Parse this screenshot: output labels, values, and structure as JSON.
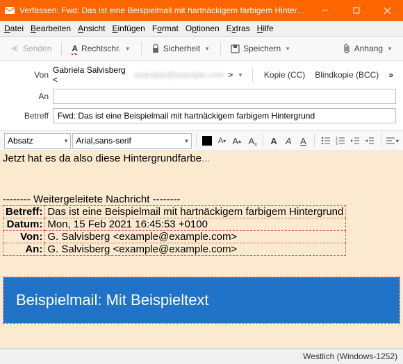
{
  "titlebar": {
    "title": "Verfassen: Fwd: Das ist eine Beispielmail mit hartnäckigem farbigem Hintergrund - Thunderbird"
  },
  "menu": {
    "datei": "Datei",
    "bearbeiten": "Bearbeiten",
    "ansicht": "Ansicht",
    "einfuegen": "Einfügen",
    "format": "Format",
    "optionen": "Optionen",
    "extras": "Extras",
    "hilfe": "Hilfe"
  },
  "toolbar": {
    "senden": "Senden",
    "rechtschr": "Rechtschr.",
    "sicherheit": "Sicherheit",
    "speichern": "Speichern",
    "anhang": "Anhang"
  },
  "fields": {
    "von_label": "Von",
    "from_name": "Gabriela Salvisberg <",
    "from_masked": "example@example.com",
    "from_close": ">",
    "kopie": "Kopie (CC)",
    "blindkopie": "Blindkopie (BCC)",
    "an_label": "An",
    "an_value": "",
    "betreff_label": "Betreff",
    "betreff_value": "Fwd: Das ist eine Beispielmail mit hartnäckigem farbigem Hintergrund"
  },
  "format": {
    "paragraph": "Absatz",
    "font": "Arial,sans-serif"
  },
  "body": {
    "typed": "Jetzt hat es da also diese Hintergrundfarbe",
    "cursor_tail": "...",
    "fwd_divider": "-------- Weitergeleitete Nachricht --------",
    "rows": {
      "betreff_k": "Betreff:",
      "betreff_v": "Das ist eine Beispielmail mit hartnäckigem farbigem Hintergrund",
      "datum_k": "Datum:",
      "datum_v": "Mon, 15 Feb 2021 16:45:53 +0100",
      "von_k": "Von:",
      "von_v": "G. Salvisberg <example@example.com>",
      "an_k": "An:",
      "an_v": "G. Salvisberg <example@example.com>"
    },
    "banner": "Beispielmail: Mit Beispieltext"
  },
  "status": {
    "encoding": "Westlich (Windows-1252)"
  }
}
